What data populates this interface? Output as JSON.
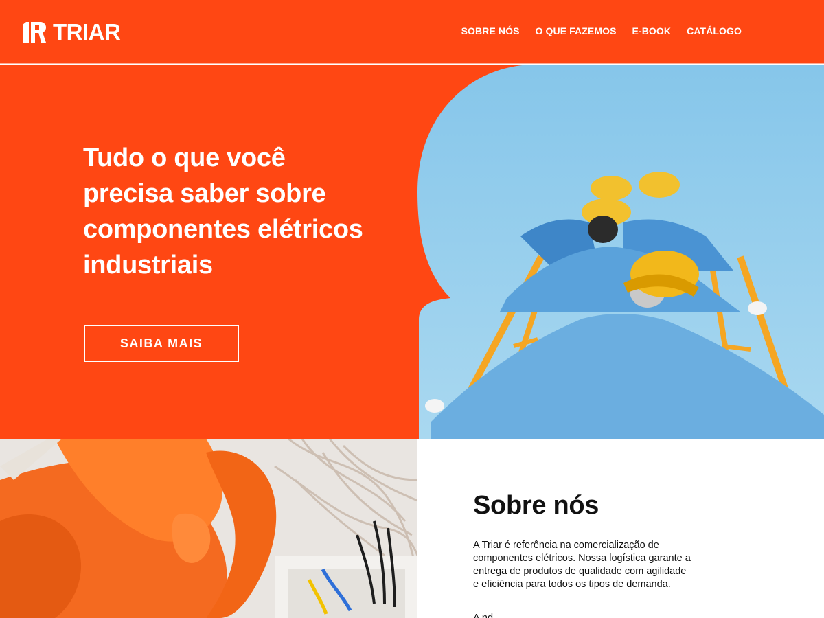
{
  "header": {
    "logo_text": "TRIAR",
    "nav": [
      {
        "label": "SOBRE NÓS"
      },
      {
        "label": "O QUE FAZEMOS"
      },
      {
        "label": "E-BOOK"
      },
      {
        "label": "CATÁLOGO"
      }
    ]
  },
  "hero": {
    "title": "Tudo o que você precisa saber sobre componentes elétricos industriais",
    "cta_label": "SAIBA MAIS"
  },
  "about": {
    "title": "Sobre nós",
    "text": "A Triar é referência na comercialização de componentes elétricos. Nossa logística garante a entrega de produtos de qualidade com agilidade e eficiência para todos os tipos de demanda.",
    "more": "A nd"
  },
  "colors": {
    "brand": "#FF4713",
    "sky": "#8DCBEA",
    "white": "#FFFFFF",
    "text": "#111111"
  }
}
